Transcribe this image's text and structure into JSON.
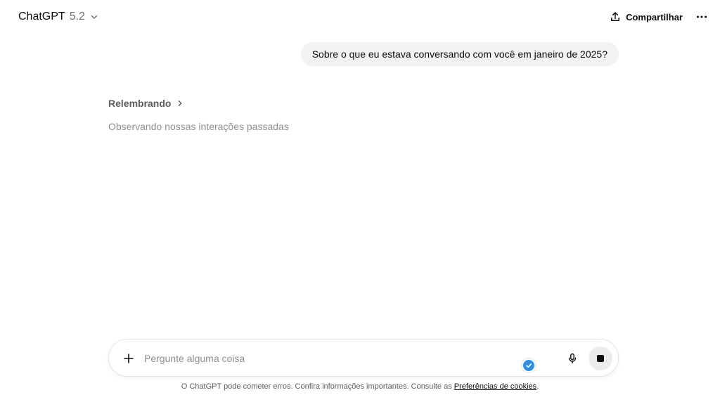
{
  "header": {
    "model_name": "ChatGPT",
    "model_version": "5.2",
    "share_label": "Compartilhar"
  },
  "conversation": {
    "user_message": "Sobre o que eu estava conversando com você em janeiro de 2025?",
    "thinking_label": "Relembrando",
    "thinking_detail": "Observando nossas interações passadas"
  },
  "composer": {
    "placeholder": "Pergunte alguma coisa",
    "value": ""
  },
  "footer": {
    "disclaimer_text": "O ChatGPT pode cometer erros. Confira informações importantes. Consulte as ",
    "cookies_link": "Preferências de cookies",
    "disclaimer_end": "."
  },
  "icons": {
    "model_chevron": "chevron-down-icon",
    "share": "share-icon",
    "more": "more-horizontal-icon",
    "thinking_chevron": "chevron-right-icon",
    "plus": "plus-icon",
    "check": "check-icon",
    "mic": "microphone-icon",
    "stop": "stop-icon"
  },
  "colors": {
    "accent_blue": "#2f8fe8",
    "bubble_bg": "#f2f2f2",
    "stop_bg": "#ececec"
  }
}
